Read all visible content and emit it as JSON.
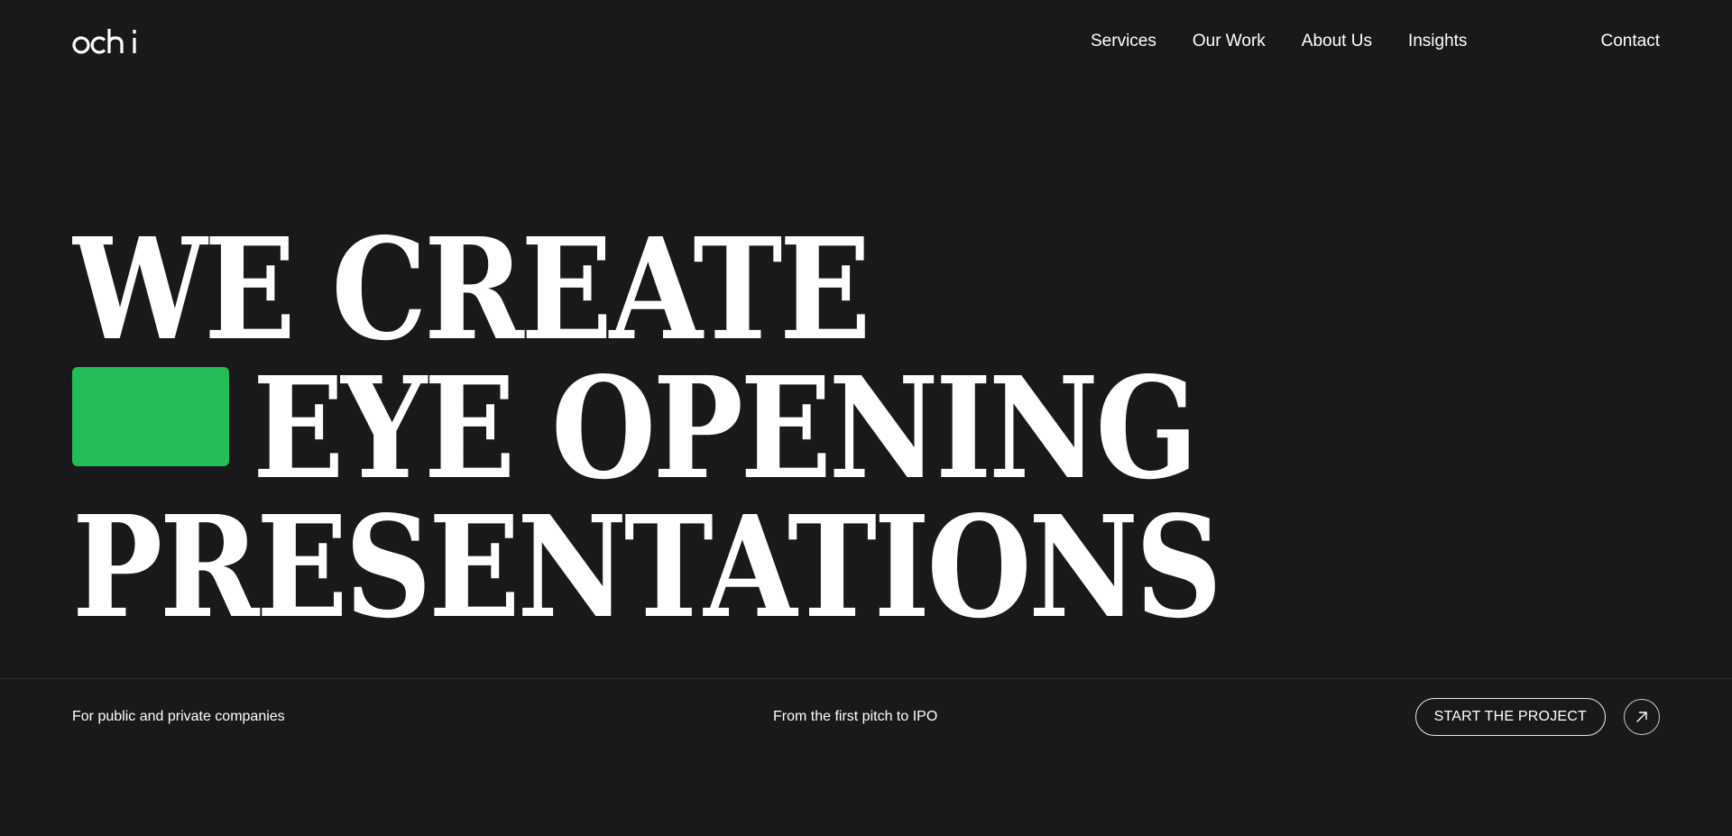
{
  "brand": {
    "logo_text": "ochi",
    "accent_color": "#23bd58",
    "background": "#19191b"
  },
  "nav": {
    "items": [
      {
        "label": "Services"
      },
      {
        "label": "Our Work"
      },
      {
        "label": "About Us"
      },
      {
        "label": "Insights"
      }
    ],
    "contact_label": "Contact"
  },
  "hero": {
    "lines": [
      "WE CREATE",
      "EYE OPENING",
      "PRESENTATIONS"
    ]
  },
  "bottom": {
    "tag_left": "For public and private companies",
    "tag_mid": "From the first pitch to IPO",
    "cta_label": "START THE PROJECT",
    "cta_icon": "arrow-up-right-icon"
  }
}
